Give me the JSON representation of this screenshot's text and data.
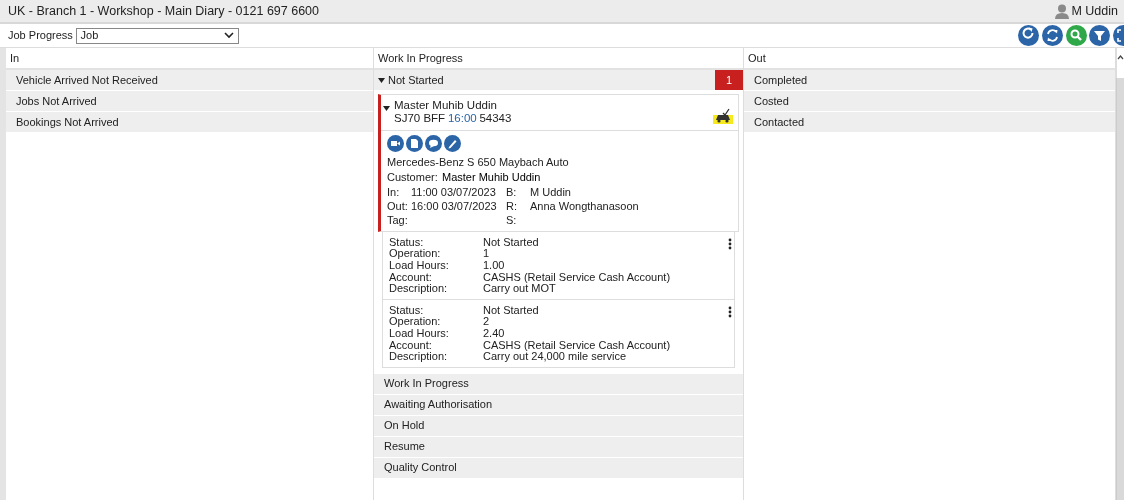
{
  "window": {
    "title": "UK - Branch 1 - Workshop - Main Diary - 0121 697 6600",
    "user": "M Uddin"
  },
  "toolbar": {
    "label": "Job Progress",
    "select_value": "Job",
    "buttons": [
      {
        "kind": "refresh",
        "color": "#2b65a8"
      },
      {
        "kind": "sync",
        "color": "#2b65a8"
      },
      {
        "kind": "search",
        "color": "#2fa84a"
      },
      {
        "kind": "filter",
        "color": "#2b65a8"
      },
      {
        "kind": "fullscreen",
        "color": "#2b65a8"
      }
    ]
  },
  "columns": [
    {
      "heading": "In",
      "groups": [
        {
          "label": "Vehicle Arrived Not Received",
          "expanded": false
        },
        {
          "label": "Jobs Not Arrived",
          "expanded": false
        },
        {
          "label": "Bookings Not Arrived",
          "expanded": false
        }
      ]
    },
    {
      "heading": "Work In Progress",
      "groups": [
        {
          "label": "Not Started",
          "expanded": true,
          "count": "1",
          "jobs": [
            {
              "expanded": true,
              "name": "Master Muhib Uddin",
              "reg": "SJ70 BFF",
              "time": "16:00",
              "number": "54343",
              "vehicle": "Mercedes-Benz S 650 Maybach Auto",
              "customer_label": "Customer:",
              "customer": "Master Muhib Uddin",
              "details": [
                {
                  "label": "In:",
                  "value": "11:00 03/07/2023",
                  "label2": "B:",
                  "value2": "M Uddin"
                },
                {
                  "label": "Out:",
                  "value": "16:00 03/07/2023",
                  "label2": "R:",
                  "value2": "Anna Wongthanasoon"
                },
                {
                  "label": "Tag:",
                  "label2": "S:"
                }
              ],
              "operations": [
                {
                  "fields": [
                    {
                      "label": "Status:",
                      "value": "Not Started"
                    },
                    {
                      "label": "Operation:",
                      "value": "1"
                    },
                    {
                      "label": "Load Hours:",
                      "value": "1.00"
                    },
                    {
                      "label": "Account:",
                      "value": "CASHS (Retail Service Cash Account)"
                    },
                    {
                      "label": "Description:",
                      "value": "Carry out MOT"
                    }
                  ]
                },
                {
                  "fields": [
                    {
                      "label": "Status:",
                      "value": "Not Started"
                    },
                    {
                      "label": "Operation:",
                      "value": "2"
                    },
                    {
                      "label": "Load Hours:",
                      "value": "2.40"
                    },
                    {
                      "label": "Account:",
                      "value": "CASHS (Retail Service Cash Account)"
                    },
                    {
                      "label": "Description:",
                      "value": "Carry out 24,000 mile service"
                    }
                  ]
                }
              ]
            }
          ]
        },
        {
          "label": "Work In Progress",
          "expanded": false
        },
        {
          "label": "Awaiting Authorisation",
          "expanded": false
        },
        {
          "label": "On Hold",
          "expanded": false
        },
        {
          "label": "Resume",
          "expanded": false
        },
        {
          "label": "Quality Control",
          "expanded": false
        }
      ]
    },
    {
      "heading": "Out",
      "groups": [
        {
          "label": "Completed",
          "expanded": false
        },
        {
          "label": "Costed",
          "expanded": false
        },
        {
          "label": "Contacted",
          "expanded": false
        }
      ]
    }
  ]
}
